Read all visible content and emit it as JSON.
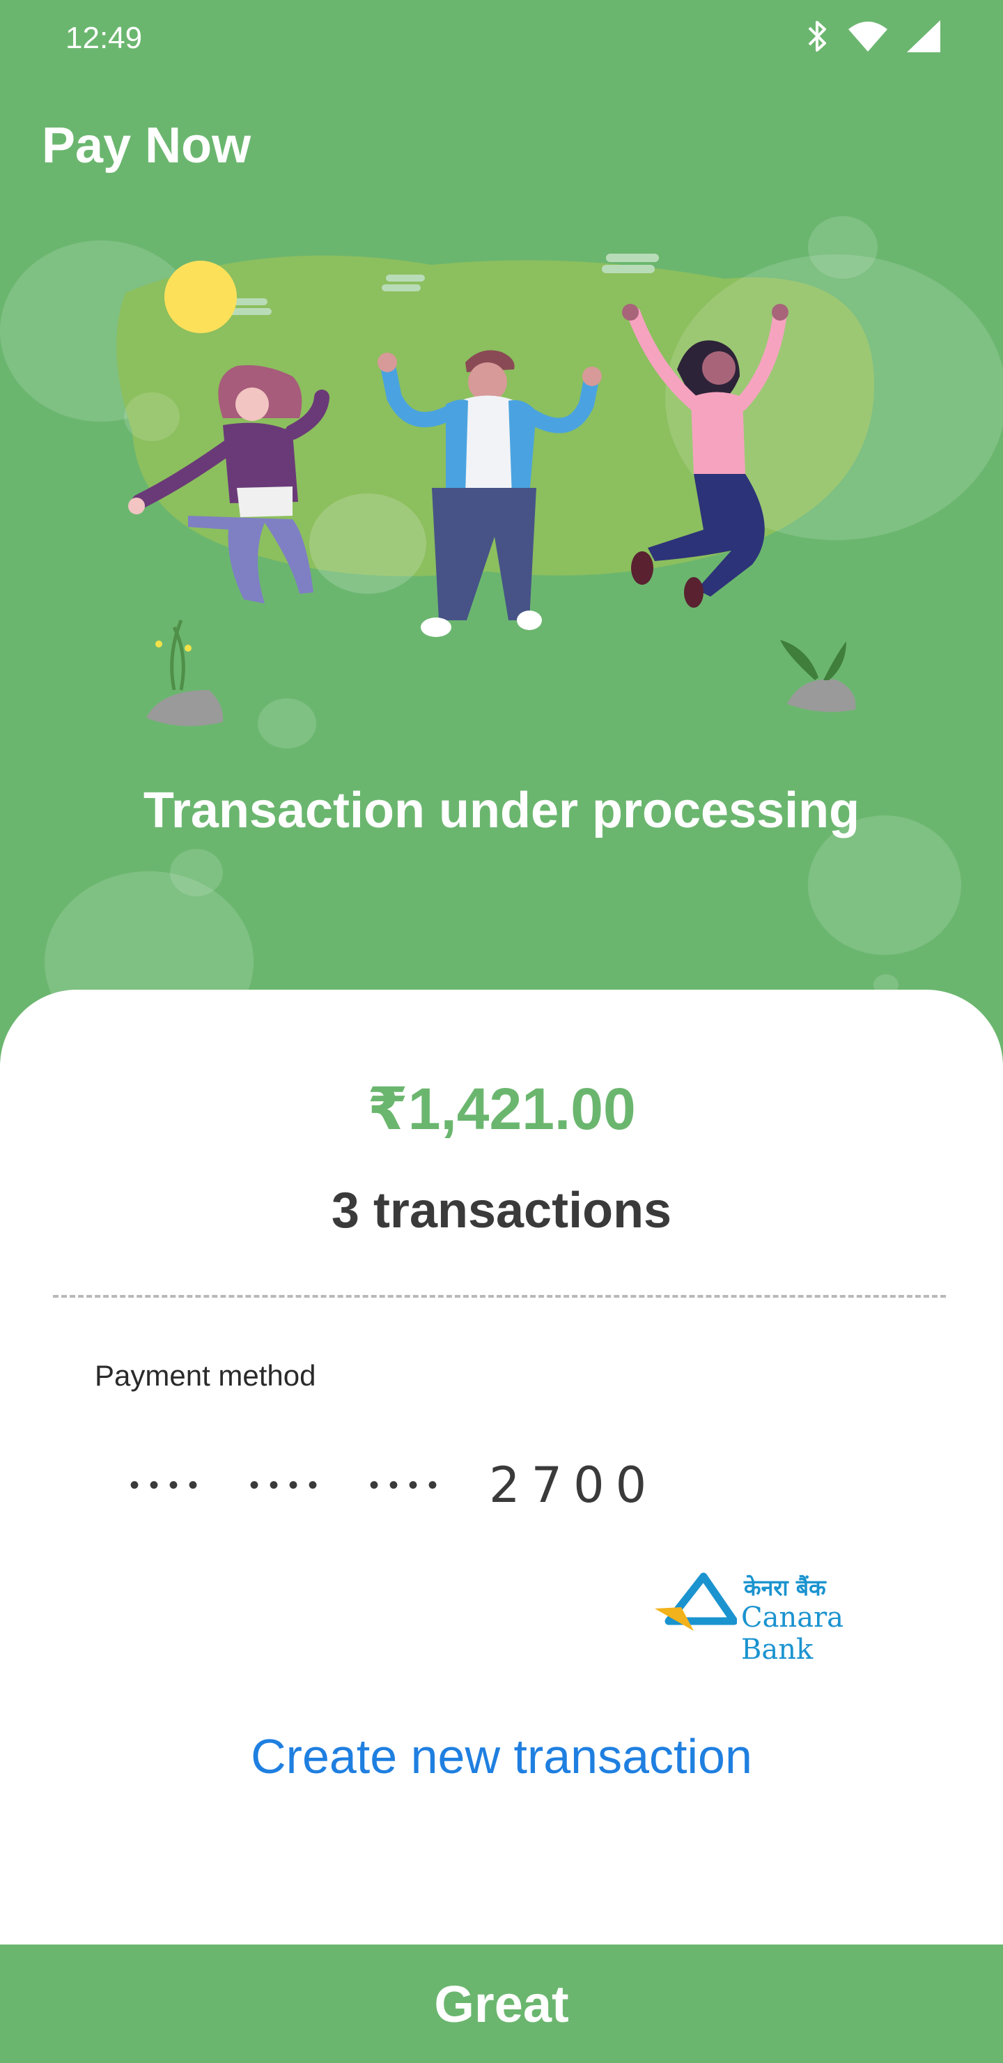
{
  "status_bar": {
    "time": "12:49",
    "icons": [
      "bluetooth-icon",
      "wifi-icon",
      "signal-icon"
    ]
  },
  "header": {
    "title": "Pay Now"
  },
  "hero": {
    "status_message": "Transaction under processing"
  },
  "summary": {
    "amount": "₹1,421.00",
    "transaction_count": "3 transactions"
  },
  "payment": {
    "label": "Payment method",
    "card_mask": [
      "••••",
      "••••",
      "••••"
    ],
    "card_last4": "2700",
    "bank_name": "Canara Bank",
    "bank_name_hindi": "केनरा बैंक"
  },
  "actions": {
    "create_new": "Create new transaction",
    "confirm": "Great"
  },
  "colors": {
    "primary_green": "#6bb66f",
    "link_blue": "#1f7fe0",
    "bank_blue": "#1b93cf",
    "bank_yellow": "#f2b21b"
  }
}
